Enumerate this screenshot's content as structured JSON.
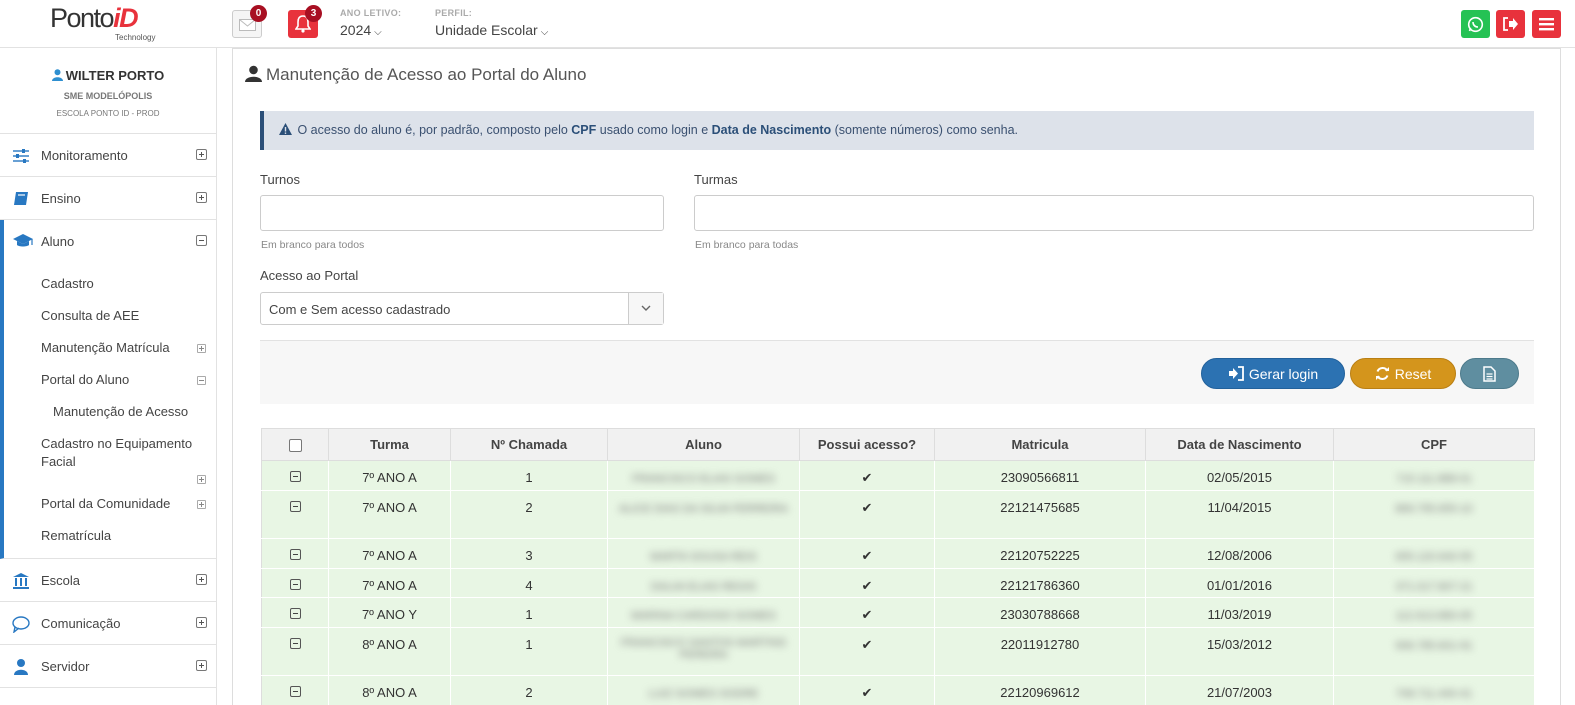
{
  "brand": {
    "name": "Ponto",
    "accent": "iD",
    "tagline": "Technology"
  },
  "header": {
    "mail_count": "0",
    "notif_count": "3",
    "ano_label": "ANO LETIVO:",
    "ano_value": "2024",
    "perfil_label": "PERFIL:",
    "perfil_value": "Unidade Escolar"
  },
  "user": {
    "name": "WILTER PORTO",
    "org": "SME MODELÓPOLIS",
    "school": "ESCOLA PONTO ID - PROD"
  },
  "sidebar": {
    "items_top": [
      {
        "label": "Monitoramento",
        "icon": "sliders-icon"
      },
      {
        "label": "Ensino",
        "icon": "book-icon"
      }
    ],
    "active": {
      "label": "Aluno",
      "icon": "graduation-cap-icon",
      "children": [
        {
          "label": "Cadastro"
        },
        {
          "label": "Consulta de AEE"
        },
        {
          "label": "Manutenção Matrícula"
        },
        {
          "label": "Portal do Aluno"
        },
        {
          "label": "Manutenção de Acesso"
        },
        {
          "label": "Cadastro no Equipamento"
        },
        {
          "label": "Facial"
        },
        {
          "label": "Portal da Comunidade"
        },
        {
          "label": "Rematrícula"
        }
      ]
    },
    "items_bottom": [
      {
        "label": "Escola",
        "icon": "bank-icon"
      },
      {
        "label": "Comunicação",
        "icon": "chat-bubble-icon"
      },
      {
        "label": "Servidor",
        "icon": "user-icon"
      }
    ]
  },
  "page": {
    "title": "Manutenção de Acesso ao Portal do Aluno",
    "alert_pre": "O acesso do aluno é, por padrão, composto pelo ",
    "alert_cpf": "CPF",
    "alert_mid": " usado como login e ",
    "alert_dn": "Data de Nascimento",
    "alert_post": " (somente números) como senha."
  },
  "form": {
    "turnos_label": "Turnos",
    "turnos_value": "",
    "turnos_help": "Em branco para todos",
    "turmas_label": "Turmas",
    "turmas_value": "",
    "turmas_help": "Em branco para todas",
    "acesso_label": "Acesso ao Portal",
    "acesso_value": "Com e Sem acesso cadastrado"
  },
  "actions": {
    "gerar": "Gerar login",
    "reset": "Reset"
  },
  "table": {
    "headers": [
      "Turma",
      "Nº Chamada",
      "Aluno",
      "Possui acesso?",
      "Matricula",
      "Data de Nascimento",
      "CPF"
    ],
    "rows": [
      {
        "turma": "7º ANO A",
        "chamada": "1",
        "aluno": "FRANCISCO ELIAS GOMES",
        "acesso": "✔",
        "matricula": "23090566811",
        "nascimento": "02/05/2015",
        "cpf": "715.111.888-01"
      },
      {
        "turma": "7º ANO A",
        "chamada": "2",
        "aluno": "ALICE DIAS DA SILVA FERREIRA",
        "acesso": "✔",
        "matricula": "22121475685",
        "nascimento": "11/04/2015",
        "cpf": "869.795.655-10"
      },
      {
        "turma": "7º ANO A",
        "chamada": "3",
        "aluno": "MARTA SOUSA REIS",
        "acesso": "✔",
        "matricula": "22120752225",
        "nascimento": "12/08/2006",
        "cpf": "655.120.640-55"
      },
      {
        "turma": "7º ANO A",
        "chamada": "4",
        "aluno": "DALVA ELIAS REGIS",
        "acesso": "✔",
        "matricula": "22121786360",
        "nascimento": "01/01/2016",
        "cpf": "371.017.807-21"
      },
      {
        "turma": "7º ANO Y",
        "chamada": "1",
        "aluno": "MARINA CARDOSO GOMES",
        "acesso": "✔",
        "matricula": "23030788668",
        "nascimento": "11/03/2019",
        "cpf": "112.613.880-05"
      },
      {
        "turma": "8º ANO A",
        "chamada": "1",
        "aluno": "FRANCISCO SANTOS MARTINS PEREIRA",
        "acesso": "✔",
        "matricula": "22011912780",
        "nascimento": "15/03/2012",
        "cpf": "906.785.601-91"
      },
      {
        "turma": "8º ANO A",
        "chamada": "2",
        "aluno": "LUIZ GOMES SODRE",
        "acesso": "✔",
        "matricula": "22120969612",
        "nascimento": "21/07/2003",
        "cpf": "708.711.440-41"
      }
    ]
  },
  "colors": {
    "accent_red": "#e8323c",
    "primary_blue": "#2c72b2",
    "reset_orange": "#d4951c",
    "row_green": "#e8f6e4",
    "whatsapp_green": "#25c254"
  }
}
